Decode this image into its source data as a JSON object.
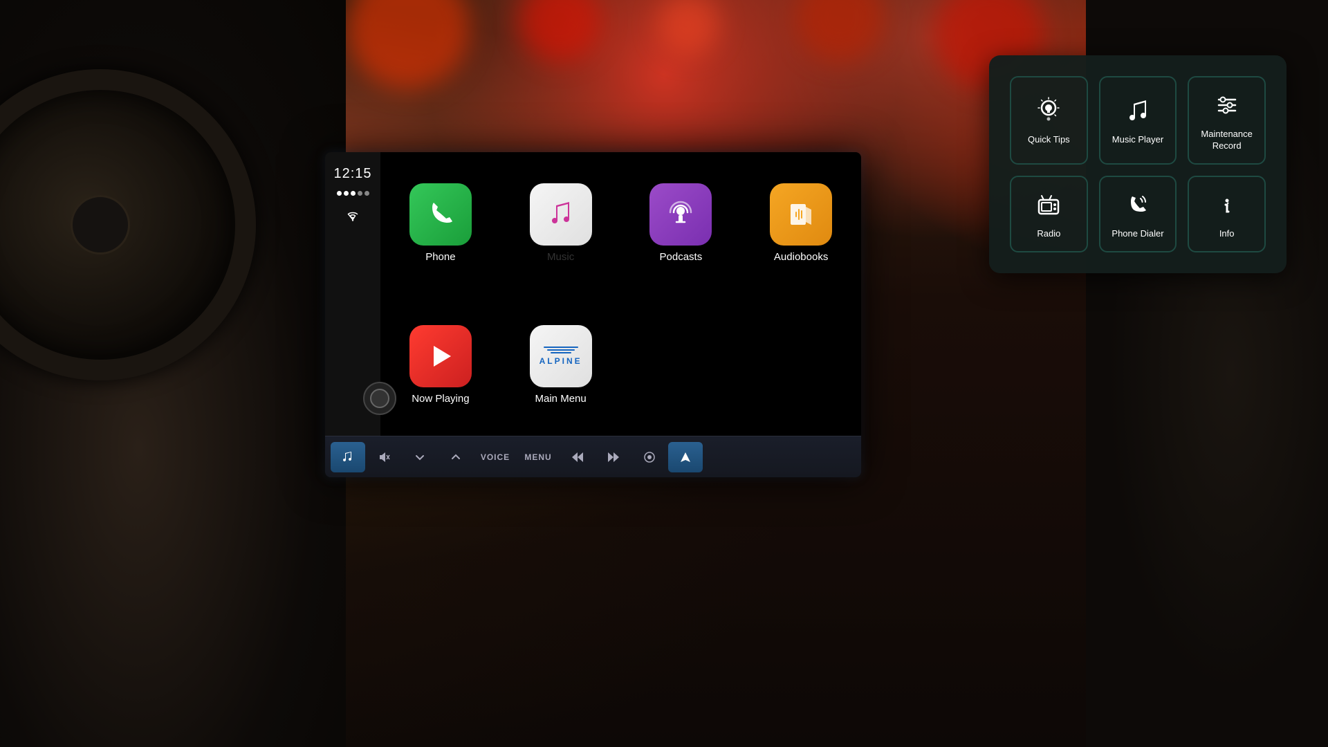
{
  "background": {
    "description": "Car interior with bokeh background"
  },
  "statusBar": {
    "time": "12:15",
    "timeLabel": "clock"
  },
  "apps": [
    {
      "id": "phone",
      "label": "Phone",
      "iconType": "phone",
      "color1": "#34c759",
      "color2": "#1a9e3a"
    },
    {
      "id": "music",
      "label": "Music",
      "iconType": "music",
      "color1": "#f5f5f5",
      "color2": "#e0e0e0"
    },
    {
      "id": "podcasts",
      "label": "Podcasts",
      "iconType": "podcasts",
      "color1": "#9b4bc8",
      "color2": "#7a2fb0"
    },
    {
      "id": "audiobooks",
      "label": "Audiobooks",
      "iconType": "audiobooks",
      "color1": "#f5a623",
      "color2": "#e08a10"
    },
    {
      "id": "now-playing",
      "label": "Now Playing",
      "iconType": "now-playing",
      "color1": "#ff3b30",
      "color2": "#cc2020"
    },
    {
      "id": "main-menu",
      "label": "Main Menu",
      "iconType": "main-menu",
      "color1": "#f5f5f5",
      "color2": "#e0e0e0"
    }
  ],
  "controlBar": {
    "buttons": [
      {
        "id": "music-btn",
        "icon": "♪",
        "active": true
      },
      {
        "id": "mute-btn",
        "icon": "🔇",
        "active": false
      },
      {
        "id": "down-btn",
        "icon": "∨",
        "active": false
      },
      {
        "id": "up-btn",
        "icon": "∧",
        "active": false
      },
      {
        "id": "voice-btn",
        "label": "VOICE",
        "active": false
      },
      {
        "id": "menu-btn",
        "label": "MENU",
        "active": false
      },
      {
        "id": "prev-btn",
        "icon": "⏮",
        "active": false
      },
      {
        "id": "next-btn",
        "icon": "⏭",
        "active": false
      },
      {
        "id": "home-btn",
        "icon": "⏺",
        "active": false
      },
      {
        "id": "nav-btn",
        "icon": "⬆",
        "active": true
      }
    ]
  },
  "popupMenu": {
    "items": [
      {
        "id": "quick-tips",
        "label": "Quick Tips",
        "iconType": "bulb"
      },
      {
        "id": "music-player",
        "label": "Music Player",
        "iconType": "music-note"
      },
      {
        "id": "maintenance-record",
        "label": "Maintenance Record",
        "iconType": "wrench"
      },
      {
        "id": "radio",
        "label": "Radio",
        "iconType": "radio"
      },
      {
        "id": "phone-dialer",
        "label": "Phone Dialer",
        "iconType": "phone-dialer"
      },
      {
        "id": "info",
        "label": "Info",
        "iconType": "info"
      }
    ]
  }
}
